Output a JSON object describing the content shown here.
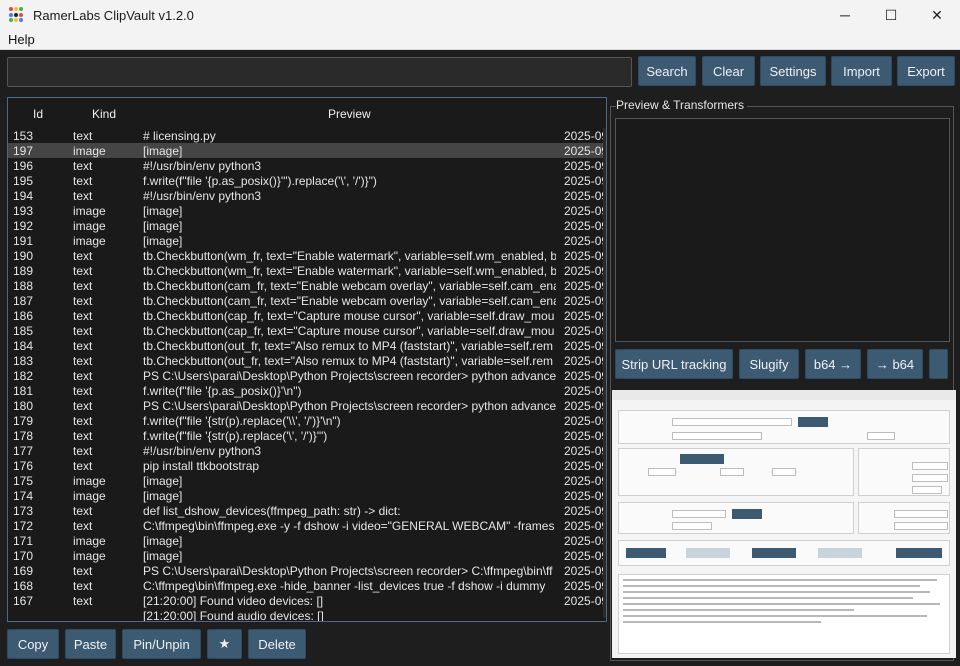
{
  "window": {
    "title": "RamerLabs ClipVault v1.2.0",
    "controls": {
      "minimize": "─",
      "maximize": "☐",
      "close": "✕"
    }
  },
  "menu": {
    "items": [
      "Help"
    ]
  },
  "search": {
    "value": "",
    "placeholder": ""
  },
  "toolbar": {
    "search": "Search",
    "clear": "Clear",
    "settings": "Settings",
    "import": "Import",
    "export": "Export"
  },
  "list": {
    "columns": {
      "id": "Id",
      "kind": "Kind",
      "preview": "Preview"
    },
    "selected_index": 1,
    "rows": [
      {
        "id": "153",
        "kind": "text",
        "preview": "# licensing.py",
        "date": "2025-09-"
      },
      {
        "id": "197",
        "kind": "image",
        "preview": "[image]",
        "date": "2025-09-"
      },
      {
        "id": "196",
        "kind": "text",
        "preview": "#!/usr/bin/env python3",
        "date": "2025-09-"
      },
      {
        "id": "195",
        "kind": "text",
        "preview": "f.write(f\"file '{p.as_posix()}'\").replace('\\', '/')}\")",
        "date": "2025-09-"
      },
      {
        "id": "194",
        "kind": "text",
        "preview": "#!/usr/bin/env python3",
        "date": "2025-09-"
      },
      {
        "id": "193",
        "kind": "image",
        "preview": "[image]",
        "date": "2025-09-"
      },
      {
        "id": "192",
        "kind": "image",
        "preview": "[image]",
        "date": "2025-09-"
      },
      {
        "id": "191",
        "kind": "image",
        "preview": "[image]",
        "date": "2025-09-"
      },
      {
        "id": "190",
        "kind": "text",
        "preview": "tb.Checkbutton(wm_fr, text=\"Enable watermark\", variable=self.wm_enabled, b",
        "date": "2025-09-"
      },
      {
        "id": "189",
        "kind": "text",
        "preview": "tb.Checkbutton(wm_fr, text=\"Enable watermark\", variable=self.wm_enabled, b",
        "date": "2025-09-"
      },
      {
        "id": "188",
        "kind": "text",
        "preview": "tb.Checkbutton(cam_fr, text=\"Enable webcam overlay\", variable=self.cam_ena",
        "date": "2025-09-"
      },
      {
        "id": "187",
        "kind": "text",
        "preview": "tb.Checkbutton(cam_fr, text=\"Enable webcam overlay\", variable=self.cam_ena",
        "date": "2025-09-"
      },
      {
        "id": "186",
        "kind": "text",
        "preview": "tb.Checkbutton(cap_fr, text=\"Capture mouse cursor\", variable=self.draw_mou",
        "date": "2025-09-"
      },
      {
        "id": "185",
        "kind": "text",
        "preview": "tb.Checkbutton(cap_fr, text=\"Capture mouse cursor\", variable=self.draw_mou",
        "date": "2025-09-"
      },
      {
        "id": "184",
        "kind": "text",
        "preview": "tb.Checkbutton(out_fr, text=\"Also remux to MP4 (faststart)\", variable=self.rem",
        "date": "2025-09-"
      },
      {
        "id": "183",
        "kind": "text",
        "preview": "tb.Checkbutton(out_fr, text=\"Also remux to MP4 (faststart)\", variable=self.rem",
        "date": "2025-09-"
      },
      {
        "id": "182",
        "kind": "text",
        "preview": "PS C:\\Users\\parai\\Desktop\\Python Projects\\screen recorder> python advanced",
        "date": "2025-09-"
      },
      {
        "id": "181",
        "kind": "text",
        "preview": "f.write(f\"file '{p.as_posix()}'\\n\")",
        "date": "2025-09-"
      },
      {
        "id": "180",
        "kind": "text",
        "preview": "PS C:\\Users\\parai\\Desktop\\Python Projects\\screen recorder> python advanced",
        "date": "2025-09-"
      },
      {
        "id": "179",
        "kind": "text",
        "preview": "f.write(f\"file '{str(p).replace('\\\\', '/')}'\\n\")",
        "date": "2025-09-"
      },
      {
        "id": "178",
        "kind": "text",
        "preview": " f.write(f\"file '{str(p).replace('\\', '/')}'\")",
        "date": "2025-09-"
      },
      {
        "id": "177",
        "kind": "text",
        "preview": "#!/usr/bin/env python3",
        "date": "2025-09-"
      },
      {
        "id": "176",
        "kind": "text",
        "preview": "pip install ttkbootstrap",
        "date": "2025-09-"
      },
      {
        "id": "175",
        "kind": "image",
        "preview": "[image]",
        "date": "2025-09-"
      },
      {
        "id": "174",
        "kind": "image",
        "preview": "[image]",
        "date": "2025-09-"
      },
      {
        "id": "173",
        "kind": "text",
        "preview": "def list_dshow_devices(ffmpeg_path: str) -> dict:",
        "date": "2025-09-"
      },
      {
        "id": "172",
        "kind": "text",
        "preview": "C:\\ffmpeg\\bin\\ffmpeg.exe -y -f dshow -i video=\"GENERAL WEBCAM\" -frames",
        "date": "2025-09-"
      },
      {
        "id": "171",
        "kind": "image",
        "preview": "[image]",
        "date": "2025-09-"
      },
      {
        "id": "170",
        "kind": "image",
        "preview": "[image]",
        "date": "2025-09-"
      },
      {
        "id": "169",
        "kind": "text",
        "preview": "PS C:\\Users\\parai\\Desktop\\Python Projects\\screen recorder>  C:\\ffmpeg\\bin\\ff",
        "date": "2025-09-"
      },
      {
        "id": "168",
        "kind": "text",
        "preview": "C:\\ffmpeg\\bin\\ffmpeg.exe -hide_banner -list_devices true -f dshow -i dummy",
        "date": "2025-09-"
      },
      {
        "id": "167",
        "kind": "text",
        "preview": "[21:20:00] Found video devices: []",
        "date": "2025-09-"
      },
      {
        "id": "",
        "kind": "",
        "preview": " [21:20:00] Found audio devices: []",
        "date": ""
      }
    ]
  },
  "bottom": {
    "copy": "Copy",
    "paste": "Paste",
    "pin": "Pin/Unpin",
    "star": "★",
    "delete": "Delete"
  },
  "preview": {
    "title": "Preview & Transformers",
    "text": "",
    "transformers": {
      "strip_url": "Strip URL tracking",
      "slugify": "Slugify",
      "b64_encode": "b64 →",
      "b64_decode": "→ b64"
    }
  },
  "colors": {
    "accent": "#3d5a73",
    "background": "#1e1e1e",
    "selected_row": "#454545"
  }
}
